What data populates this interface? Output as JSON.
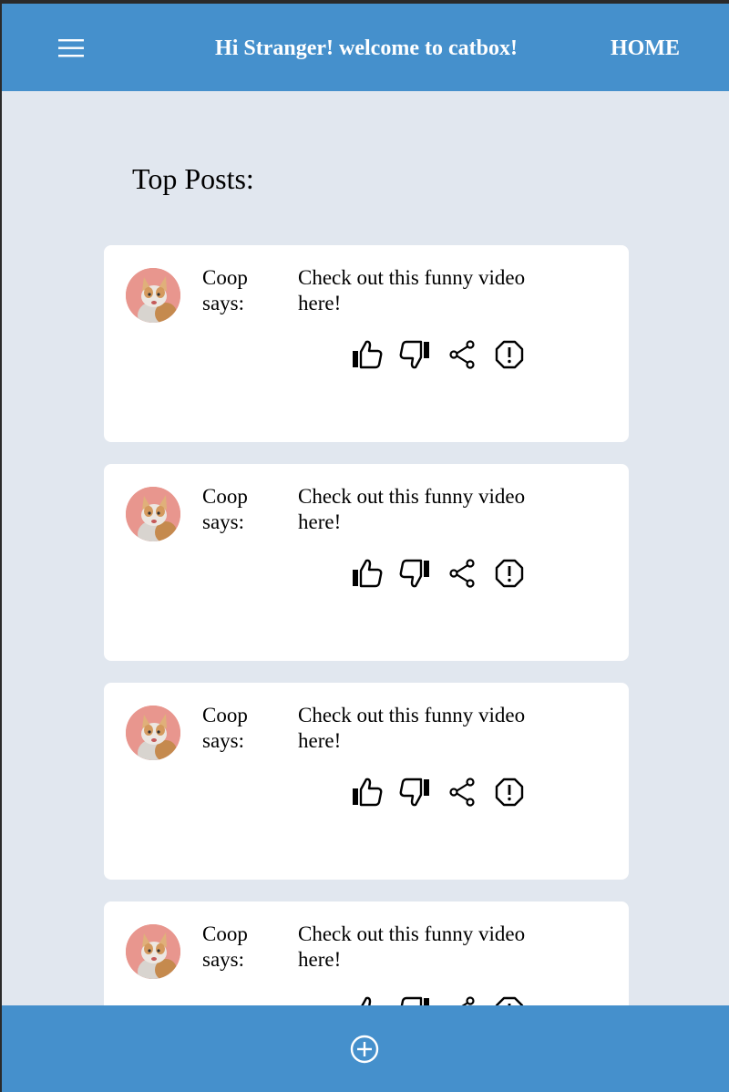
{
  "header": {
    "title": "Hi Stranger! welcome to catbox!",
    "home_label": "HOME",
    "menu_icon": "hamburger-menu-icon"
  },
  "main": {
    "section_title": "Top Posts:",
    "posts": [
      {
        "author": "Coop",
        "says": "says:",
        "message": "Check out this funny video here!"
      },
      {
        "author": "Coop",
        "says": "says:",
        "message": "Check out this funny video here!"
      },
      {
        "author": "Coop",
        "says": "says:",
        "message": "Check out this funny video here!"
      },
      {
        "author": "Coop",
        "says": "says:",
        "message": "Check out this funny video here!"
      }
    ],
    "post_actions": [
      "thumbs-up-icon",
      "thumbs-down-icon",
      "share-icon",
      "report-icon"
    ]
  },
  "footer": {
    "add_icon": "add-circle-icon"
  },
  "colors": {
    "brand": "#4590cc",
    "background": "#e1e7ef",
    "card": "#ffffff"
  }
}
